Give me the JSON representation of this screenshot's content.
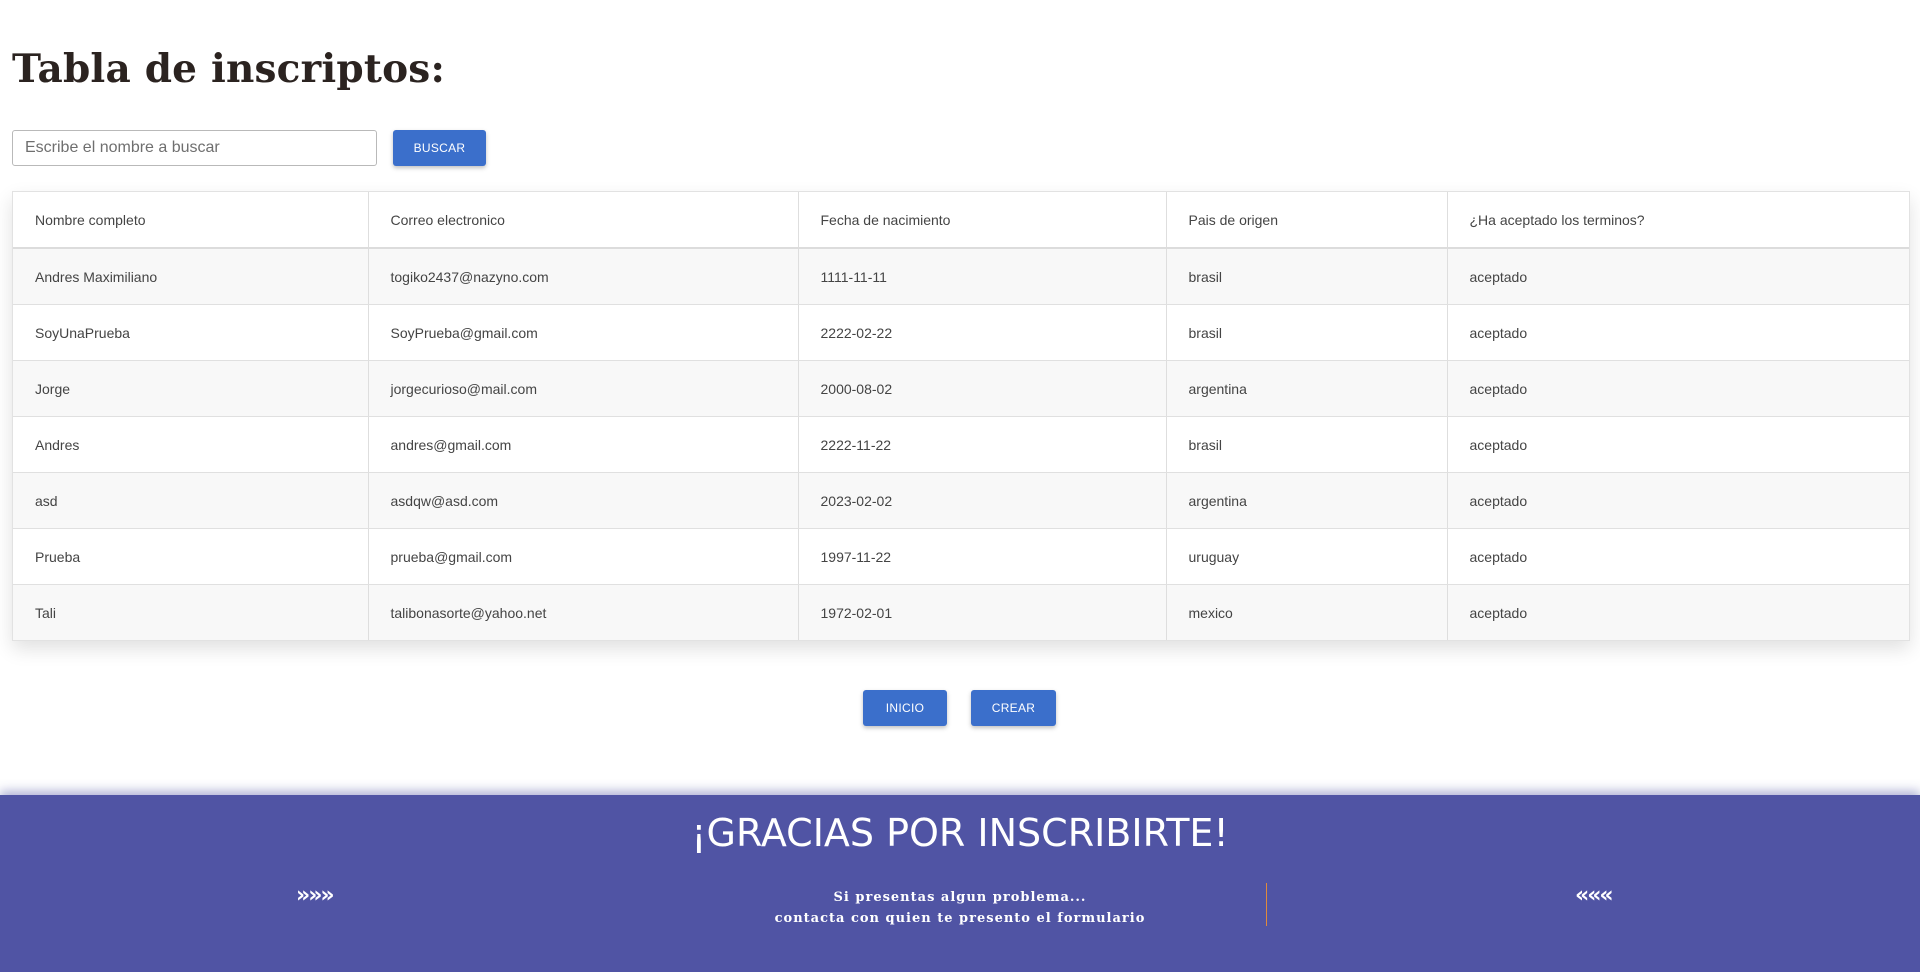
{
  "page": {
    "title": "Tabla de inscriptos:"
  },
  "search": {
    "placeholder": "Escribe el nombre a buscar",
    "value": "",
    "button_label": "BUSCAR"
  },
  "table": {
    "headers": [
      "Nombre completo",
      "Correo electronico",
      "Fecha de nacimiento",
      "Pais de origen",
      "¿Ha aceptado los terminos?"
    ],
    "rows": [
      [
        "Andres Maximiliano",
        "togiko2437@nazyno.com",
        "1111-11-11",
        "brasil",
        "aceptado"
      ],
      [
        "SoyUnaPrueba",
        "SoyPrueba@gmail.com",
        "2222-02-22",
        "brasil",
        "aceptado"
      ],
      [
        "Jorge",
        "jorgecurioso@mail.com",
        "2000-08-02",
        "argentina",
        "aceptado"
      ],
      [
        "Andres",
        "andres@gmail.com",
        "2222-11-22",
        "brasil",
        "aceptado"
      ],
      [
        "asd",
        "asdqw@asd.com",
        "2023-02-02",
        "argentina",
        "aceptado"
      ],
      [
        "Prueba",
        "prueba@gmail.com",
        "1997-11-22",
        "uruguay",
        "aceptado"
      ],
      [
        "Tali",
        "talibonasorte@yahoo.net",
        "1972-02-01",
        "mexico",
        "aceptado"
      ]
    ]
  },
  "actions": {
    "inicio_label": "INICIO",
    "crear_label": "CREAR"
  },
  "footer": {
    "title": "¡GRACIAS POR INSCRIBIRTE!",
    "left_decoration": "»»»",
    "right_decoration": "«««",
    "message_line1": "Si presentas algun problema...",
    "message_line2": "contacta con quien te presento el formulario"
  },
  "colors": {
    "accent": "#3b6fcb",
    "footer_background": "#5054a4",
    "divider": "#e08a3c",
    "title_text": "#2b2320"
  }
}
